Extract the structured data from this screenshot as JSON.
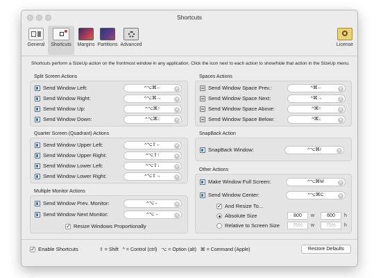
{
  "window": {
    "title": "Shortcuts"
  },
  "toolbar": {
    "items": [
      {
        "label": "General",
        "icon": "general-icon"
      },
      {
        "label": "Shortcuts",
        "icon": "shortcuts-icon",
        "selected": true
      },
      {
        "label": "Margins",
        "icon": "margins-icon"
      },
      {
        "label": "Partitions",
        "icon": "partitions-icon"
      },
      {
        "label": "Advanced",
        "icon": "advanced-icon"
      }
    ],
    "license_label": "License"
  },
  "intro": "Shortcuts perform a SizeUp action on the frontmost window in any application. Click the icon next to each action to show/hide that action in the SizeUp menu.",
  "split_screen": {
    "title": "Split Screen Actions",
    "rows": [
      {
        "label": "Send Window Left:",
        "shortcut": "^⌥⌘←"
      },
      {
        "label": "Send Window Right:",
        "shortcut": "^⌥⌘→"
      },
      {
        "label": "Send Window Up:",
        "shortcut": "^⌥⌘↑"
      },
      {
        "label": "Send Window Down:",
        "shortcut": "^⌥⌘↓"
      }
    ]
  },
  "quarter_screen": {
    "title": "Quarter Screen (Quadrant) Actions",
    "rows": [
      {
        "label": "Send Window Upper Left:",
        "shortcut": "^⌥⇧←"
      },
      {
        "label": "Send Window Upper Right:",
        "shortcut": "^⌥⇧↑"
      },
      {
        "label": "Send Window Lower Left:",
        "shortcut": "^⌥⇧↓"
      },
      {
        "label": "Send Window Lower Right:",
        "shortcut": "^⌥⇧→"
      }
    ]
  },
  "multi_monitor": {
    "title": "Multiple Monitor Actions",
    "rows": [
      {
        "label": "Send Window Prev. Monitor:",
        "shortcut": "^⌥←"
      },
      {
        "label": "Send Window Next Monitor:",
        "shortcut": "^⌥→"
      }
    ],
    "resize_label": "Resize Windows Proportionally",
    "resize_checked": true
  },
  "spaces": {
    "title": "Spaces Actions",
    "rows": [
      {
        "label": "Send Window Space Prev.:",
        "shortcut": "^⌘←"
      },
      {
        "label": "Send Window Space Next:",
        "shortcut": "^⌘→"
      },
      {
        "label": "Send Window Space Above:",
        "shortcut": "^⌘↑"
      },
      {
        "label": "Send Window Space Below:",
        "shortcut": "^⌘↓"
      }
    ]
  },
  "snapback": {
    "title": "SnapBack Action",
    "label": "SnapBack Window:",
    "shortcut": "^⌥⌘/"
  },
  "other": {
    "title": "Other Actions",
    "fullscreen_label": "Make Window Full Screen:",
    "fullscreen_shortcut": "^⌥⌘M",
    "center_label": "Send Window Center:",
    "center_shortcut": "^⌥⌘C",
    "resize_to_label": "And Resize To...",
    "resize_to_checked": true,
    "absolute_label": "Absolute Size",
    "absolute_w": "800",
    "absolute_h": "600",
    "relative_label": "Relative to Screen Size",
    "relative_w": "75%",
    "relative_h": "75%",
    "w_unit": "w",
    "h_unit": "h"
  },
  "footer": {
    "enable_label": "Enable Shortcuts",
    "enable_checked": true,
    "legend": "⇧ = Shift   ^ = Control (ctrl)   ⌥ = Option (alt)   ⌘ = Command (Apple)",
    "restore_label": "Restore Defaults"
  }
}
